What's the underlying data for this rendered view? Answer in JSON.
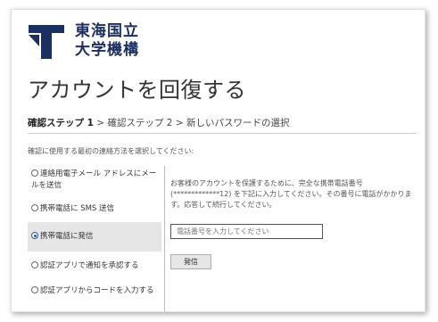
{
  "brand": {
    "logo_text_line1": "東海国立",
    "logo_text_line2": "大学機構",
    "logo_color": "#1c2f63"
  },
  "page": {
    "title": "アカウントを回復する"
  },
  "steps": {
    "step1": "確認ステップ 1",
    "sep1": " > ",
    "step2": "確認ステップ 2",
    "sep2": " > ",
    "step3": "新しいパスワードの選択"
  },
  "instruction": "確認に使用する最初の連絡方法を選択してください:",
  "options": [
    {
      "label": "連絡用電子メール アドレスにメールを送信",
      "selected": false
    },
    {
      "label": "携帯電話に SMS 送信",
      "selected": false
    },
    {
      "label": "携帯電話に発信",
      "selected": true
    },
    {
      "label": "認証アプリで通知を承認する",
      "selected": false
    },
    {
      "label": "認証アプリからコードを入力する",
      "selected": false
    }
  ],
  "detail": {
    "text": "お客様のアカウントを保護するために、完全な携帯電話番号 (*************12) を下記に入力してください。その番号に電話がかかります。応答して続行してください。"
  },
  "phone_input": {
    "placeholder": "電話番号を入力してください",
    "value": ""
  },
  "call_button": {
    "label": "発信"
  }
}
